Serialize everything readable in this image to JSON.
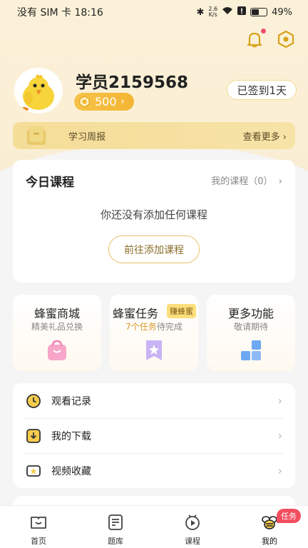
{
  "status_bar": {
    "carrier": "没有 SIM 卡",
    "time": "18:16",
    "speed_value": "2.6",
    "speed_unit": "K/s",
    "battery": "49%"
  },
  "profile": {
    "username": "学员2159568",
    "points": "500",
    "checkin_label": "已签到1天"
  },
  "weekly_report": {
    "title": "学习周报",
    "more": "查看更多"
  },
  "courses": {
    "title": "今日课程",
    "mine": "我的课程（0）",
    "empty_text": "你还没有添加任何课程",
    "add_button": "前往添加课程"
  },
  "features": [
    {
      "title": "蜂蜜商城",
      "subtitle": "精美礼品兑换"
    },
    {
      "title": "蜂蜜任务",
      "subtitle_count": "7个任务",
      "subtitle_rest": "待完成",
      "badge": "赚蜂蜜"
    },
    {
      "title": "更多功能",
      "subtitle": "敬请期待"
    }
  ],
  "menu": [
    {
      "label": "观看记录",
      "icon": "clock-icon"
    },
    {
      "label": "我的下载",
      "icon": "download-icon"
    },
    {
      "label": "视频收藏",
      "icon": "video-favorite-icon"
    }
  ],
  "tabbar": [
    {
      "label": "首页",
      "icon": "home-book-icon"
    },
    {
      "label": "题库",
      "icon": "question-bank-icon"
    },
    {
      "label": "课程",
      "icon": "course-play-icon"
    },
    {
      "label": "我的",
      "icon": "bee-icon",
      "badge": "任务"
    }
  ],
  "colors": {
    "accent": "#f3b533",
    "badge_red": "#f24e5f",
    "header_bg": "#fbf1d8"
  }
}
